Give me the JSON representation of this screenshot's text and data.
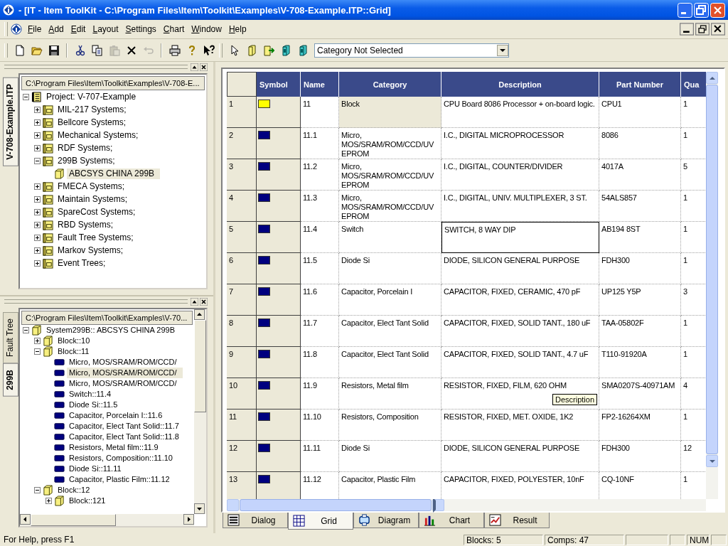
{
  "window": {
    "title": "- [IT - Item ToolKit - C:\\Program Files\\Item\\Toolkit\\Examples\\V-708-Example.ITP::Grid]"
  },
  "menu": [
    "File",
    "Add",
    "Edit",
    "Layout",
    "Settings",
    "Chart",
    "Window",
    "Help"
  ],
  "toolbar": {
    "groups": [
      {
        "buttons": [
          {
            "disabled": false
          },
          {
            "disabled": false
          },
          {
            "disabled": false
          }
        ]
      },
      {
        "buttons": [
          {
            "disabled": false
          },
          {
            "disabled": false
          },
          {
            "disabled": true
          },
          {
            "disabled": false
          },
          {
            "disabled": true
          }
        ]
      },
      {
        "buttons": [
          {
            "disabled": false
          },
          {
            "disabled": false
          },
          {
            "disabled": false
          }
        ]
      },
      {
        "buttons": [
          {
            "disabled": false
          },
          {
            "disabled": false
          },
          {
            "disabled": false
          },
          {
            "disabled": false
          },
          {
            "disabled": false
          }
        ]
      }
    ],
    "dropdown": {
      "value": "Category Not Selected"
    }
  },
  "project_pane": {
    "tabs": [
      {
        "label": "V-708-Example.ITP",
        "selected": true
      }
    ],
    "path": "C:\\Program Files\\Item\\Toolkit\\Examples\\V-708-E...",
    "tree": [
      {
        "label": "Project:  V-707-Example",
        "kind": "project",
        "expanded": true,
        "selected": false,
        "children": [
          {
            "label": "MIL-217 Systems;",
            "kind": "system",
            "expanded": false,
            "selected": false
          },
          {
            "label": "Bellcore Systems;",
            "kind": "system",
            "expanded": false,
            "selected": false
          },
          {
            "label": "Mechanical Systems;",
            "kind": "system",
            "expanded": false,
            "selected": false
          },
          {
            "label": "RDF Systems;",
            "kind": "system",
            "expanded": false,
            "selected": false
          },
          {
            "label": "299B Systems;",
            "kind": "system",
            "expanded": true,
            "selected": false,
            "children": [
              {
                "label": "ABCSYS CHINA 299B",
                "kind": "block",
                "selected": true
              }
            ]
          },
          {
            "label": "FMECA Systems;",
            "kind": "system",
            "expanded": false,
            "selected": false
          },
          {
            "label": "Maintain Systems;",
            "kind": "system",
            "expanded": false,
            "selected": false
          },
          {
            "label": "SpareCost Systems;",
            "kind": "system",
            "expanded": false,
            "selected": false
          },
          {
            "label": "RBD Systems;",
            "kind": "system",
            "expanded": false,
            "selected": false
          },
          {
            "label": "Fault Tree Systems;",
            "kind": "system",
            "expanded": false,
            "selected": false
          },
          {
            "label": "Markov Systems;",
            "kind": "system",
            "expanded": false,
            "selected": false
          },
          {
            "label": "Event Trees;",
            "kind": "system",
            "expanded": false,
            "selected": false
          }
        ]
      }
    ]
  },
  "system_pane": {
    "tabs": [
      {
        "label": "Fault Tree",
        "selected": false
      },
      {
        "label": "299B",
        "selected": true
      }
    ],
    "path": "C:\\Program Files\\Item\\Toolkit\\Examples\\V-70...",
    "tree": [
      {
        "label": "System299B:: ABCSYS CHINA 299B",
        "kind": "block",
        "expanded": true,
        "selected": false,
        "children": [
          {
            "label": "Block::10",
            "kind": "block",
            "expanded": false,
            "selected": false
          },
          {
            "label": "Block::11",
            "kind": "block",
            "expanded": true,
            "selected": false,
            "children": [
              {
                "label": "Micro, MOS/SRAM/ROM/CCD/",
                "kind": "component",
                "selected": false
              },
              {
                "label": "Micro, MOS/SRAM/ROM/CCD/",
                "kind": "component",
                "selected": true
              },
              {
                "label": "Micro, MOS/SRAM/ROM/CCD/",
                "kind": "component",
                "selected": false
              },
              {
                "label": "Switch::11.4",
                "kind": "component",
                "selected": false
              },
              {
                "label": "Diode Si::11.5",
                "kind": "component",
                "selected": false
              },
              {
                "label": "Capacitor, Porcelain I::11.6",
                "kind": "component",
                "selected": false
              },
              {
                "label": "Capacitor, Elect Tant Solid::11.7",
                "kind": "component",
                "selected": false
              },
              {
                "label": "Capacitor, Elect Tant Solid::11.8",
                "kind": "component",
                "selected": false
              },
              {
                "label": "Resistors, Metal film::11.9",
                "kind": "component",
                "selected": false
              },
              {
                "label": "Resistors, Composition::11.10",
                "kind": "component",
                "selected": false
              },
              {
                "label": "Diode Si::11.11",
                "kind": "component",
                "selected": false
              },
              {
                "label": "Capacitor, Plastic Film::11.12",
                "kind": "component",
                "selected": false
              }
            ]
          },
          {
            "label": "Block::12",
            "kind": "block",
            "expanded": true,
            "selected": false,
            "children": [
              {
                "label": "Block::121",
                "kind": "block",
                "expanded": false,
                "selected": false
              }
            ]
          }
        ]
      }
    ]
  },
  "grid": {
    "columns": [
      "Symbol",
      "Name",
      "Category",
      "Description",
      "Part Number",
      "Qua"
    ],
    "tooltip": "Description",
    "rows": [
      {
        "number": "1",
        "color": "#ffff00",
        "name": "11",
        "category": "Block",
        "category_shaded": true,
        "description": "CPU Board 8086 Processor + on-board logic.",
        "description_focused": false,
        "part_number": "CPU1",
        "qua": "1"
      },
      {
        "number": "2",
        "color": "#00007f",
        "name": "11.1",
        "category": "Micro, MOS/SRAM/ROM/CCD/UV EPROM",
        "category_shaded": false,
        "description": "I.C., DIGITAL MICROPROCESSOR",
        "description_focused": false,
        "part_number": "8086",
        "qua": "1"
      },
      {
        "number": "3",
        "color": "#00007f",
        "name": "11.2",
        "category": "Micro, MOS/SRAM/ROM/CCD/UV EPROM",
        "category_shaded": false,
        "description": "I.C., DIGITAL, COUNTER/DIVIDER",
        "description_focused": false,
        "part_number": "4017A",
        "qua": "5"
      },
      {
        "number": "4",
        "color": "#00007f",
        "name": "11.3",
        "category": "Micro, MOS/SRAM/ROM/CCD/UV EPROM",
        "category_shaded": false,
        "description": "I.C., DIGITAL, UNIV. MULTIPLEXER, 3 ST.",
        "description_focused": false,
        "part_number": "54ALS857",
        "qua": "1"
      },
      {
        "number": "5",
        "color": "#00007f",
        "name": "11.4",
        "category": "Switch",
        "category_shaded": false,
        "description": "SWITCH, 8 WAY DIP",
        "description_focused": true,
        "part_number": "AB194 8ST",
        "qua": "1"
      },
      {
        "number": "6",
        "color": "#00007f",
        "name": "11.5",
        "category": "Diode Si",
        "category_shaded": false,
        "description": "DIODE, SILICON GENERAL PURPOSE",
        "description_focused": false,
        "part_number": "FDH300",
        "qua": "1"
      },
      {
        "number": "7",
        "color": "#00007f",
        "name": "11.6",
        "category": "Capacitor, Porcelain I",
        "category_shaded": false,
        "description": "CAPACITOR, FIXED, CERAMIC, 470 pF",
        "description_focused": false,
        "part_number": "UP125 Y5P",
        "qua": "3"
      },
      {
        "number": "8",
        "color": "#00007f",
        "name": "11.7",
        "category": "Capacitor, Elect Tant Solid",
        "category_shaded": false,
        "description": "CAPACITOR, FIXED, SOLID TANT., 180 uF",
        "description_focused": false,
        "part_number": "TAA-05802F",
        "qua": "1"
      },
      {
        "number": "9",
        "color": "#00007f",
        "name": "11.8",
        "category": "Capacitor, Elect Tant Solid",
        "category_shaded": false,
        "description": "CAPACITOR, FIXED, SOLID TANT., 4.7 uF",
        "description_focused": false,
        "part_number": "T110-91920A",
        "qua": "1"
      },
      {
        "number": "10",
        "color": "#00007f",
        "name": "11.9",
        "category": "Resistors, Metal film",
        "category_shaded": false,
        "description": "RESISTOR, FIXED, FILM, 620 OHM",
        "description_focused": false,
        "part_number": "SMA0207S-40971AM",
        "qua": "4"
      },
      {
        "number": "11",
        "color": "#00007f",
        "name": "11.10",
        "category": "Resistors, Composition",
        "category_shaded": false,
        "description": "RESISTOR, FIXED, MET. OXIDE, 1K2",
        "description_focused": false,
        "part_number": "FP2-16264XM",
        "qua": "1"
      },
      {
        "number": "12",
        "color": "#00007f",
        "name": "11.11",
        "category": "Diode Si",
        "category_shaded": false,
        "description": "DIODE, SILICON GENERAL PURPOSE",
        "description_focused": false,
        "part_number": "FDH300",
        "qua": "12"
      },
      {
        "number": "13",
        "color": "#00007f",
        "name": "11.12",
        "category": "Capacitor, Plastic Film",
        "category_shaded": false,
        "description": "CAPACITOR, FIXED, POLYESTER, 10nF",
        "description_focused": false,
        "part_number": "CQ-10NF",
        "qua": "1"
      }
    ]
  },
  "view_tabs": [
    {
      "label": "Dialog",
      "selected": false
    },
    {
      "label": "Grid",
      "selected": true
    },
    {
      "label": "Diagram",
      "selected": false
    },
    {
      "label": "Chart",
      "selected": false
    },
    {
      "label": "Result",
      "selected": false
    }
  ],
  "status_bar": {
    "message": "For Help, press F1",
    "blocks": "Blocks: 5",
    "comps": "Comps: 47",
    "num": "NUM"
  }
}
